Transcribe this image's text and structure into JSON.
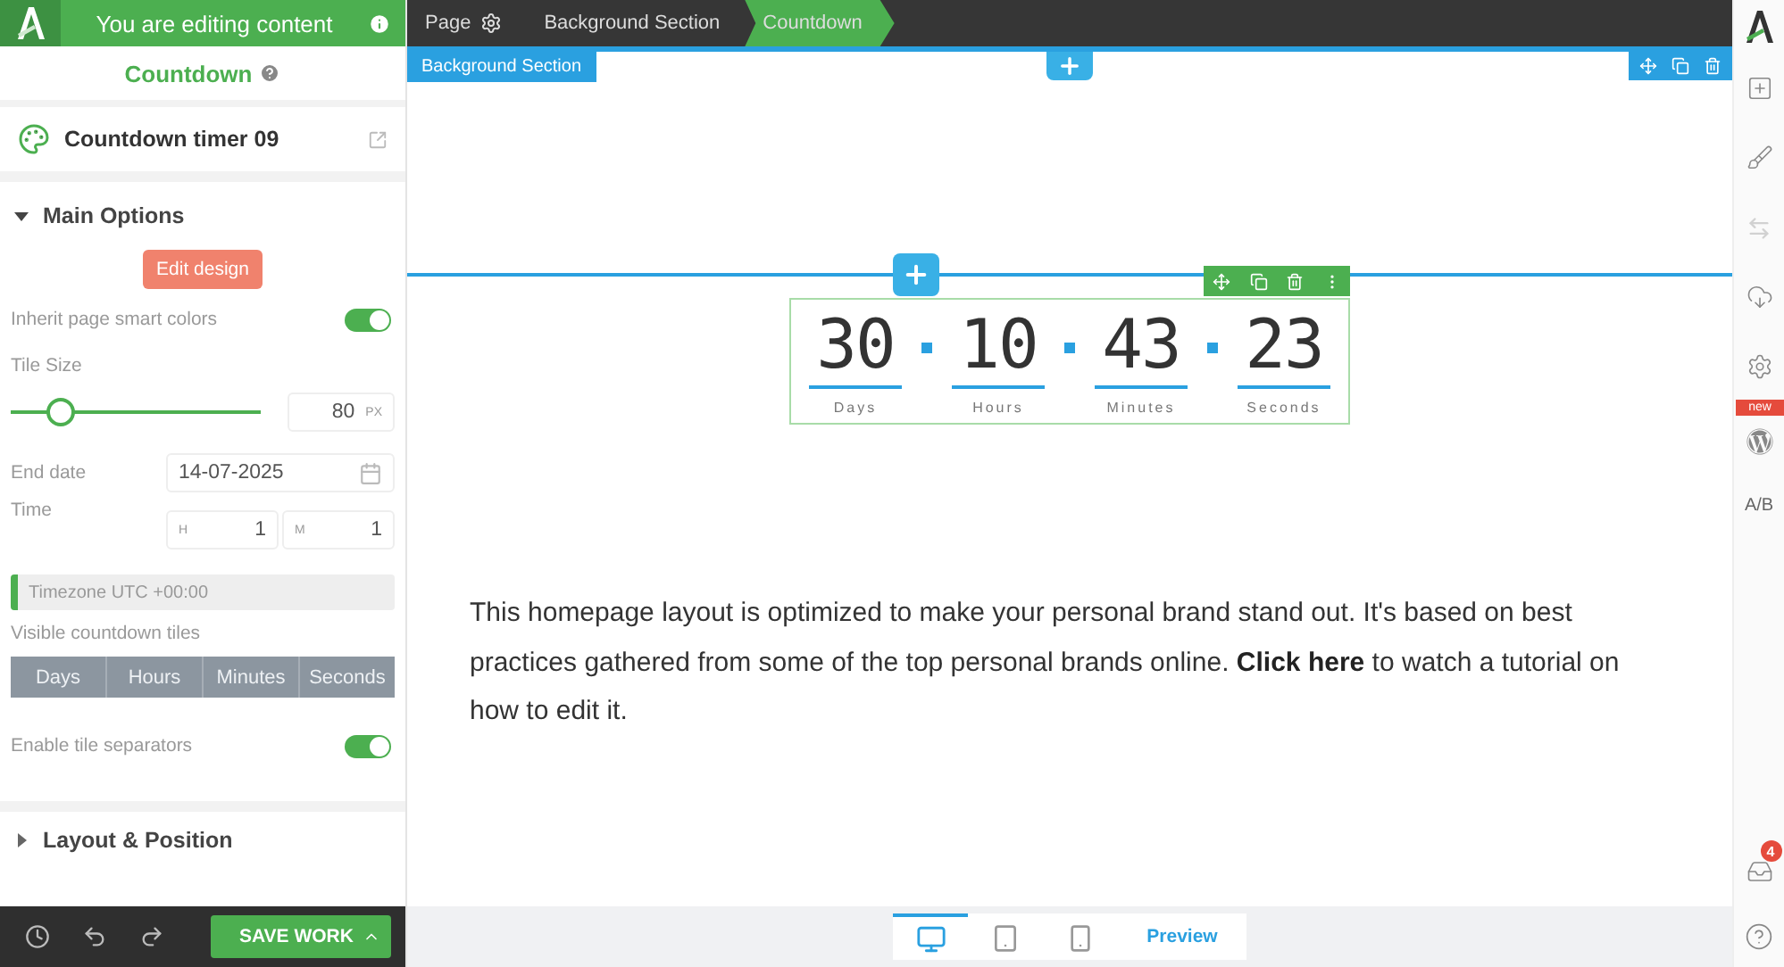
{
  "editor_banner": {
    "title": "You are editing content"
  },
  "panel": {
    "title": "Countdown",
    "element_name": "Countdown timer 09",
    "sections": [
      {
        "title": "Main Options",
        "expanded": true
      },
      {
        "title": "Layout & Position",
        "expanded": false
      }
    ],
    "edit_button": "Edit design",
    "inherit_colors": {
      "label": "Inherit page smart colors",
      "on": true
    },
    "tile_size": {
      "label": "Tile Size",
      "level": 0.2,
      "value": "80",
      "unit": "PX"
    },
    "end_date": {
      "label": "End date",
      "value": "14-07-2025"
    },
    "time": {
      "label": "Time",
      "hour_label": "H",
      "hour": "1",
      "minute_label": "M",
      "minute": "1"
    },
    "timezone_note": "Timezone UTC +00:00",
    "visible_tiles": {
      "label": "Visible countdown tiles",
      "options": [
        {
          "label": "Days",
          "selected": true
        },
        {
          "label": "Hours",
          "selected": true
        },
        {
          "label": "Minutes",
          "selected": true
        },
        {
          "label": "Seconds",
          "selected": true
        }
      ]
    },
    "separators": {
      "label": "Enable tile separators",
      "on": true
    },
    "save_button": "SAVE WORK"
  },
  "breadcrumb": [
    {
      "label": "Page",
      "kind": "page",
      "selected": false
    },
    {
      "label": "Background Section",
      "kind": "plain",
      "selected": false
    },
    {
      "label": "Countdown",
      "kind": "plain",
      "selected": true
    }
  ],
  "canvas": {
    "section_label": "Background Section",
    "countdown": [
      {
        "value": "30",
        "unit": "Days"
      },
      {
        "value": "10",
        "unit": "Hours"
      },
      {
        "value": "43",
        "unit": "Minutes"
      },
      {
        "value": "23",
        "unit": "Seconds"
      }
    ],
    "paragraph": {
      "before": "This homepage layout is optimized to make your personal brand stand out. It's based on best practices gathered from some of the top personal brands online. ",
      "link": "Click here",
      "after": " to watch a tutorial on how to edit it."
    }
  },
  "devices": [
    {
      "kind": "desktop",
      "selected": true
    },
    {
      "kind": "tablet",
      "selected": false
    },
    {
      "kind": "phone",
      "selected": false
    }
  ],
  "preview_button": "Preview",
  "rail": {
    "new_badge": "new",
    "ab_label": "A/B",
    "notifications": "4"
  }
}
